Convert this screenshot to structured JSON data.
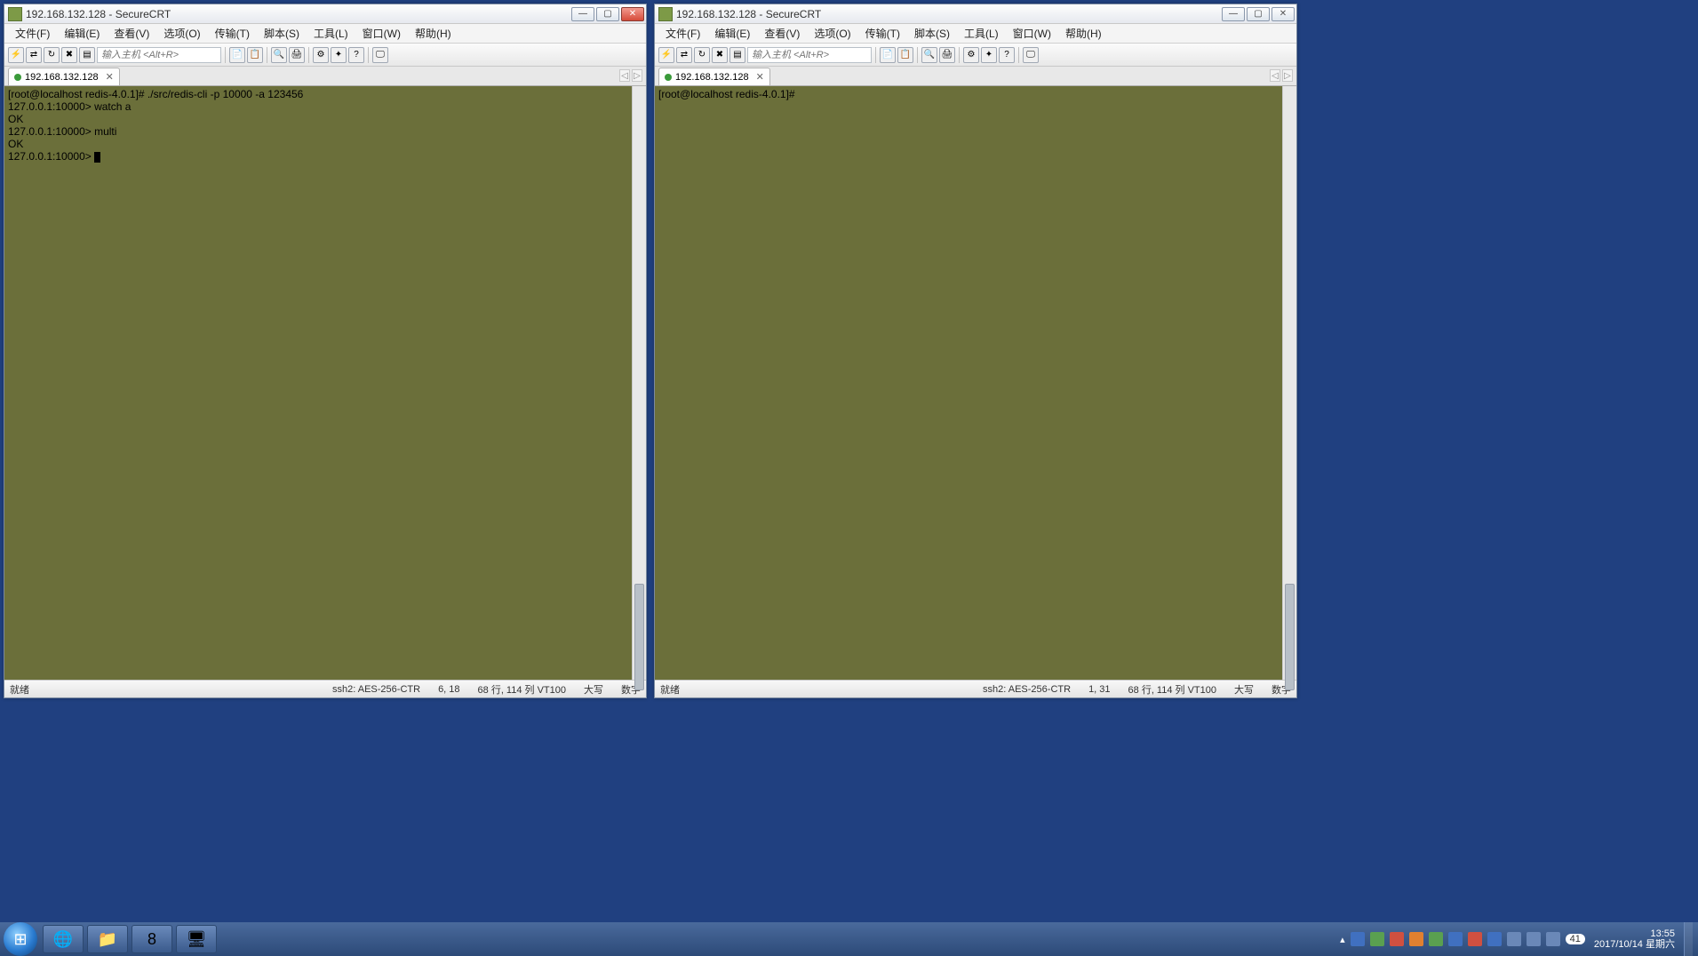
{
  "left_window": {
    "title": "192.168.132.128 - SecureCRT",
    "menu": [
      "文件(F)",
      "编辑(E)",
      "查看(V)",
      "选项(O)",
      "传输(T)",
      "脚本(S)",
      "工具(L)",
      "窗口(W)",
      "帮助(H)"
    ],
    "host_placeholder": "输入主机 <Alt+R>",
    "tab": "192.168.132.128",
    "terminal_lines": [
      "[root@localhost redis-4.0.1]# ./src/redis-cli -p 10000 -a 123456",
      "127.0.0.1:10000> watch a",
      "OK",
      "127.0.0.1:10000> multi",
      "OK",
      "127.0.0.1:10000> "
    ],
    "status": {
      "ready": "就绪",
      "conn": "ssh2: AES-256-CTR",
      "cursor": "6,  18",
      "size": "68 行, 114 列 VT100",
      "caps": "大写",
      "num": "数字"
    }
  },
  "right_window": {
    "title": "192.168.132.128 - SecureCRT",
    "menu": [
      "文件(F)",
      "编辑(E)",
      "查看(V)",
      "选项(O)",
      "传输(T)",
      "脚本(S)",
      "工具(L)",
      "窗口(W)",
      "帮助(H)"
    ],
    "host_placeholder": "输入主机 <Alt+R>",
    "tab": "192.168.132.128",
    "terminal_lines": [
      "[root@localhost redis-4.0.1]# "
    ],
    "status": {
      "ready": "就绪",
      "conn": "ssh2: AES-256-CTR",
      "cursor": "1,  31",
      "size": "68 行, 114 列 VT100",
      "caps": "大写",
      "num": "数字"
    }
  },
  "taskbar": {
    "time": "13:55",
    "date": "2017/10/14 星期六",
    "notif_count": "41"
  }
}
